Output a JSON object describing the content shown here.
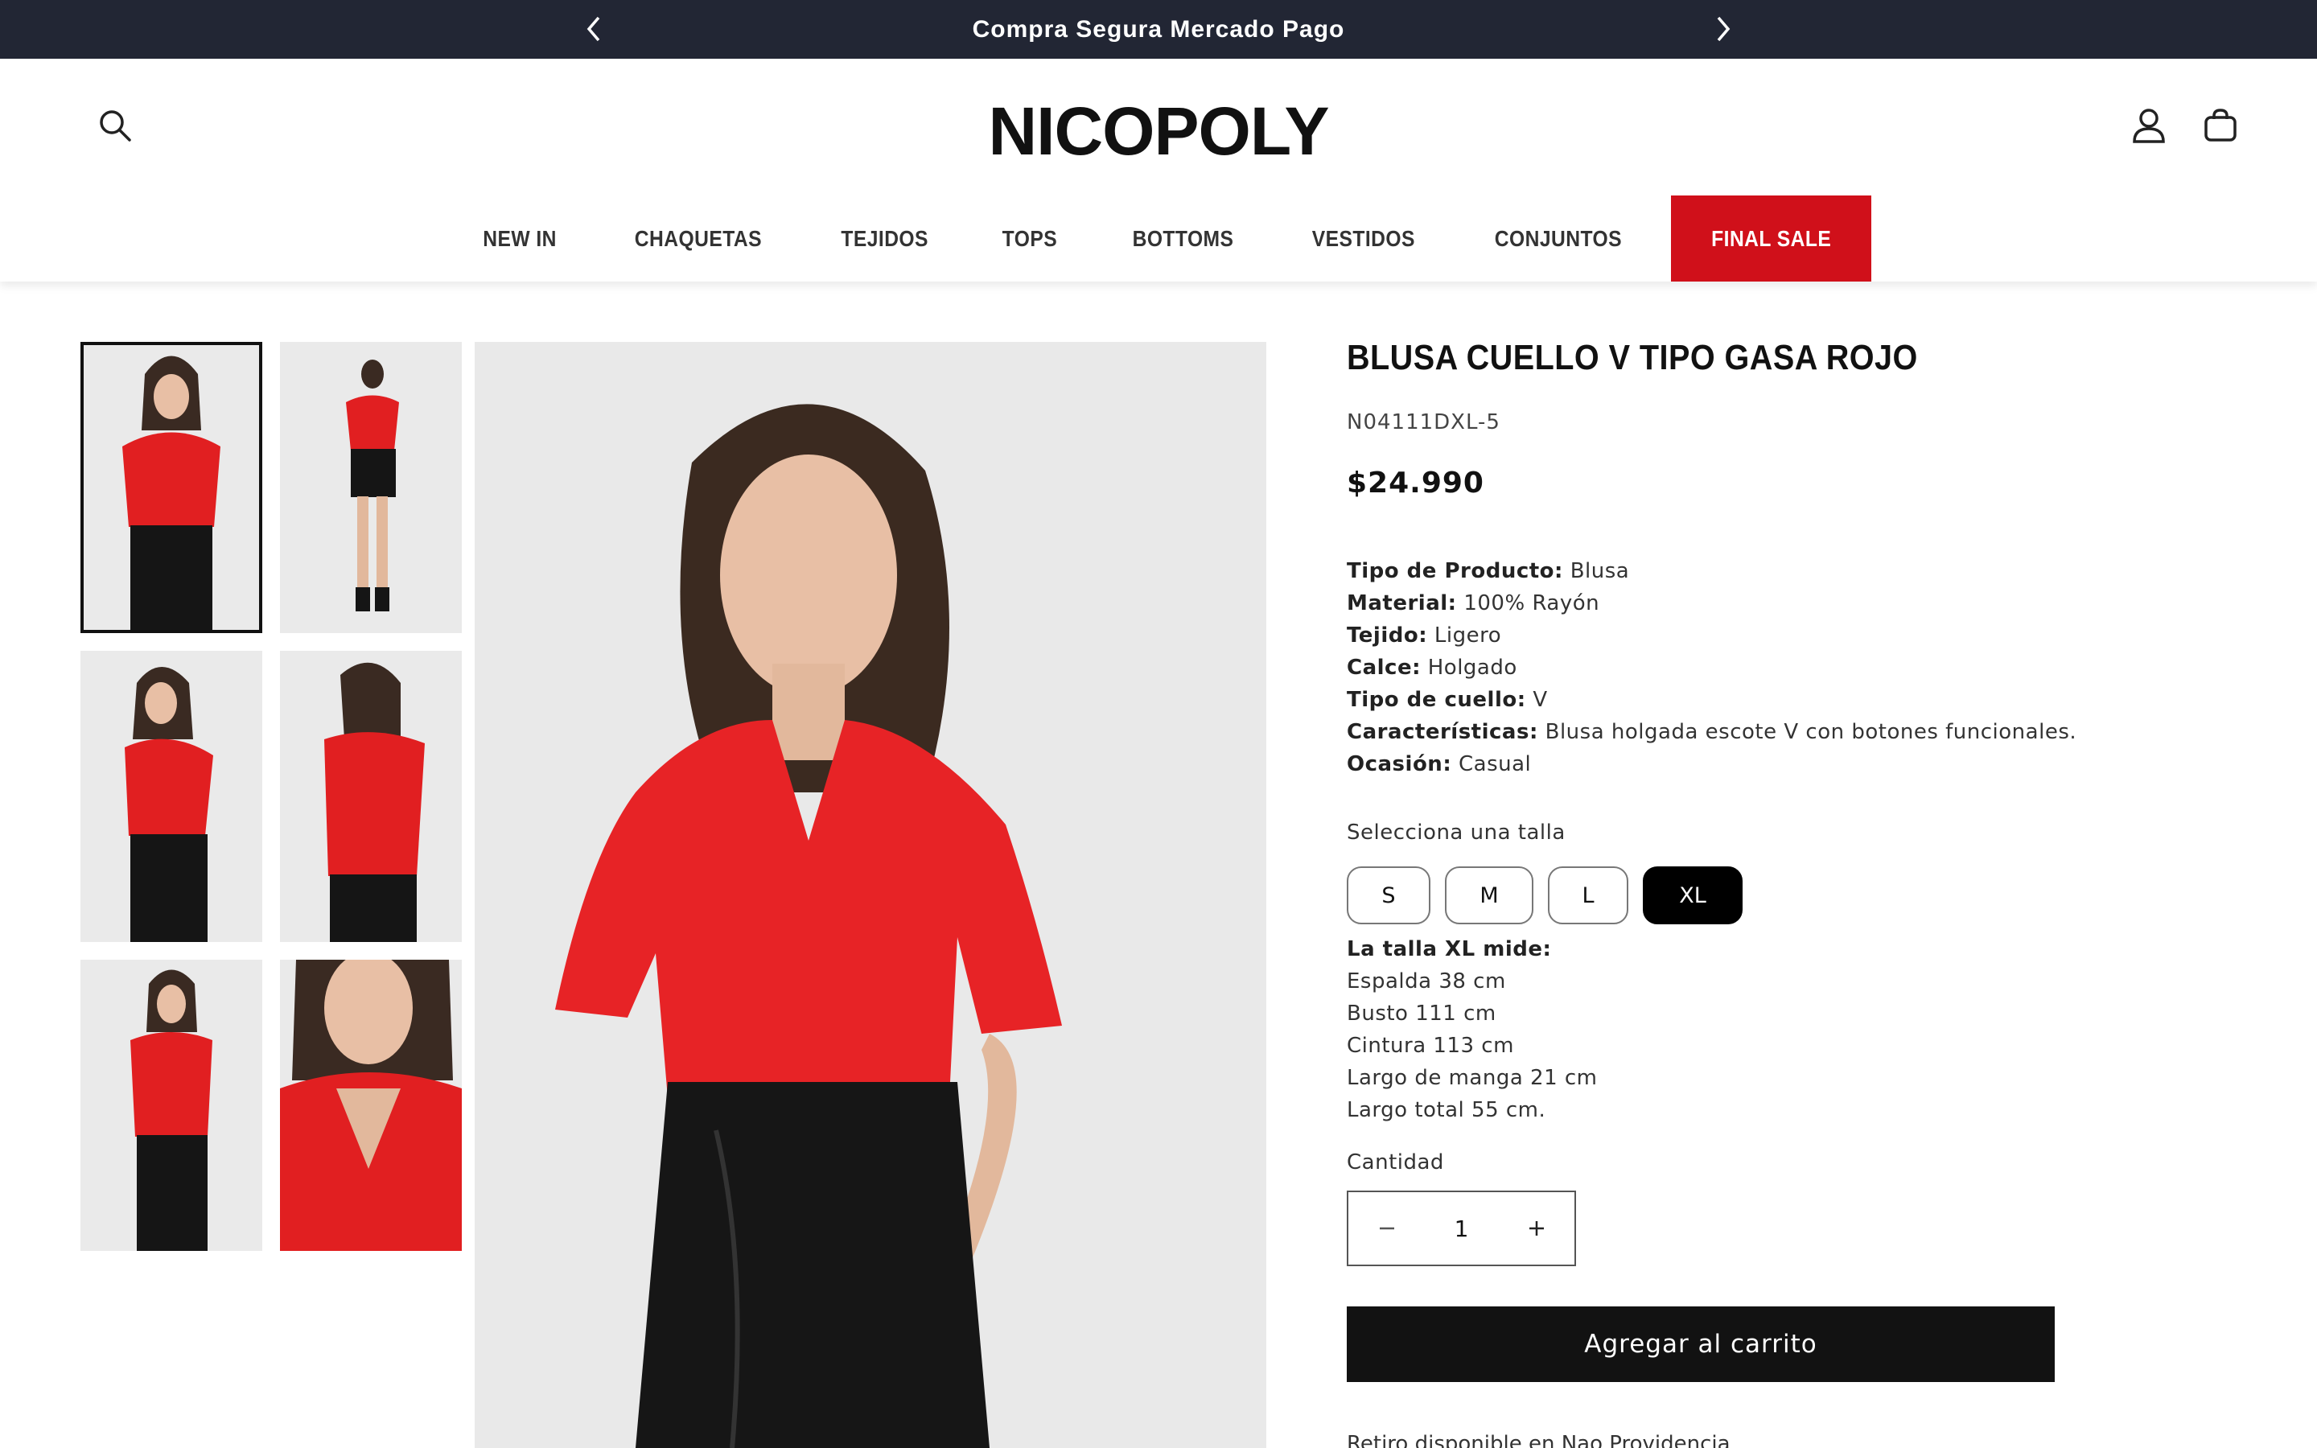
{
  "announcement": {
    "text": "Compra Segura Mercado Pago",
    "prev_icon": "chevron-left-icon",
    "next_icon": "chevron-right-icon"
  },
  "header": {
    "logo": "NICOPOLY",
    "nav": [
      "NEW IN",
      "CHAQUETAS",
      "TEJIDOS",
      "TOPS",
      "BOTTOMS",
      "VESTIDOS",
      "CONJUNTOS"
    ],
    "nav_sale": "FINAL SALE",
    "sale_color": "#d0101a"
  },
  "product": {
    "title": "BLUSA CUELLO V TIPO GASA ROJO",
    "sku": "N04111DXL-5",
    "price": "$24.990",
    "specs": [
      {
        "label": "Tipo de Producto:",
        "value": "Blusa"
      },
      {
        "label": "Material:",
        "value": "100% Rayón"
      },
      {
        "label": "Tejido:",
        "value": "Ligero"
      },
      {
        "label": "Calce:",
        "value": "Holgado"
      },
      {
        "label": "Tipo de cuello:",
        "value": "V"
      },
      {
        "label": "Características:",
        "value": "Blusa holgada escote V con botones funcionales."
      },
      {
        "label": "Ocasión:",
        "value": "Casual"
      }
    ],
    "size_label": "Selecciona una talla",
    "sizes": [
      "S",
      "M",
      "L",
      "XL"
    ],
    "selected_size": "XL",
    "measure_title": "La talla XL mide:",
    "measures": [
      "Espalda 38 cm",
      "Busto 111 cm",
      "Cintura 113 cm",
      "Largo de manga 21 cm",
      "Largo total 55 cm."
    ],
    "qty_label": "Cantidad",
    "qty_value": "1",
    "add_to_cart": "Agregar al carrito",
    "pickup_partial": "Retiro disponible en Nao Providencia"
  }
}
